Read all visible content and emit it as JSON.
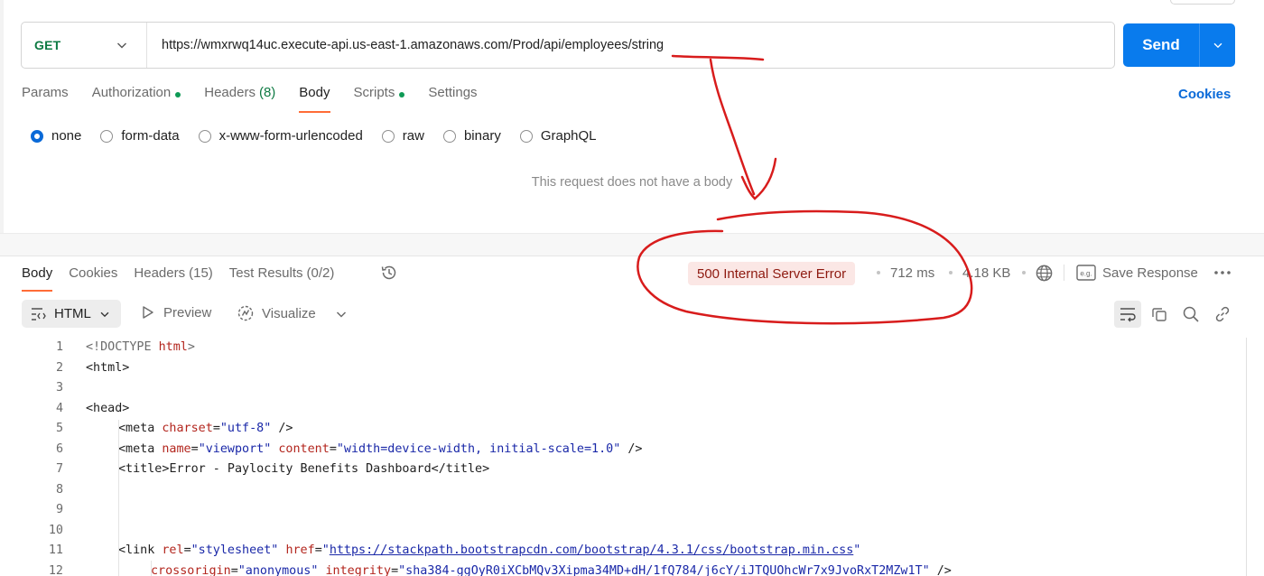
{
  "request": {
    "method": "GET",
    "url": "https://wmxrwq14uc.execute-api.us-east-1.amazonaws.com/Prod/api/employees/string",
    "send_label": "Send"
  },
  "request_tabs": [
    {
      "label": "Params",
      "dot": false
    },
    {
      "label": "Authorization",
      "dot": true
    },
    {
      "label": "Headers",
      "count": "(8)",
      "dot": false
    },
    {
      "label": "Body",
      "dot": false,
      "active": true
    },
    {
      "label": "Scripts",
      "dot": true
    },
    {
      "label": "Settings",
      "dot": false
    }
  ],
  "cookies_label": "Cookies",
  "body_types": [
    {
      "label": "none",
      "checked": true
    },
    {
      "label": "form-data",
      "checked": false
    },
    {
      "label": "x-www-form-urlencoded",
      "checked": false
    },
    {
      "label": "raw",
      "checked": false
    },
    {
      "label": "binary",
      "checked": false
    },
    {
      "label": "GraphQL",
      "checked": false
    }
  ],
  "no_body_message": "This request does not have a body",
  "response": {
    "tabs": [
      {
        "label": "Body",
        "active": true
      },
      {
        "label": "Cookies"
      },
      {
        "label": "Headers",
        "count": "(15)"
      },
      {
        "label": "Test Results",
        "count": "(0/2)"
      }
    ],
    "status": "500 Internal Server Error",
    "time": "712 ms",
    "size": "4.18 KB",
    "save_label": "Save Response",
    "format_label": "HTML",
    "preview_label": "Preview",
    "visualize_label": "Visualize"
  },
  "code_lines": [
    {
      "n": "1"
    },
    {
      "n": "2"
    },
    {
      "n": "3"
    },
    {
      "n": "4"
    },
    {
      "n": "5"
    },
    {
      "n": "6"
    },
    {
      "n": "7"
    },
    {
      "n": "8"
    },
    {
      "n": "9"
    },
    {
      "n": "10"
    },
    {
      "n": "11"
    },
    {
      "n": "12"
    }
  ],
  "code": {
    "l1_doctype": "<!DOCTYPE ",
    "l1_html": "html",
    "l1_end": ">",
    "l2": "<html>",
    "l4": "<head>",
    "l5_a": "<meta ",
    "l5_attr": "charset",
    "l5_eq": "=",
    "l5_val": "\"utf-8\"",
    "l5_end": " />",
    "l6_a": "<meta ",
    "l6_attr1": "name",
    "l6_val1": "\"viewport\"",
    "l6_attr2": "content",
    "l6_val2": "\"width=device-width, initial-scale=1.0\"",
    "l6_end": " />",
    "l7_a": "<title>",
    "l7_text": "Error - Paylocity Benefits Dashboard",
    "l7_end": "</title>",
    "l11_a": "<link ",
    "l11_attr1": "rel",
    "l11_val1": "\"stylesheet\"",
    "l11_attr2": "href",
    "l11_q1": "\"",
    "l11_url": "https://stackpath.bootstrapcdn.com/bootstrap/4.3.1/css/bootstrap.min.css",
    "l11_q2": "\"",
    "l12_attr1": "crossorigin",
    "l12_val1": "\"anonymous\"",
    "l12_attr2": "integrity",
    "l12_val2": "\"sha384-ggOyR0iXCbMQv3Xipma34MD+dH/1fQ784/j6cY/iJTQUOhcWr7x9JvoRxT2MZw1T\"",
    "l12_end": " />"
  },
  "colors": {
    "send": "#097bed",
    "method": "#0e7a43",
    "status_bg": "#fbe7e5",
    "status_text": "#8e1a10",
    "active_tab": "#ff6c37",
    "annotation": "#d81c1c"
  }
}
